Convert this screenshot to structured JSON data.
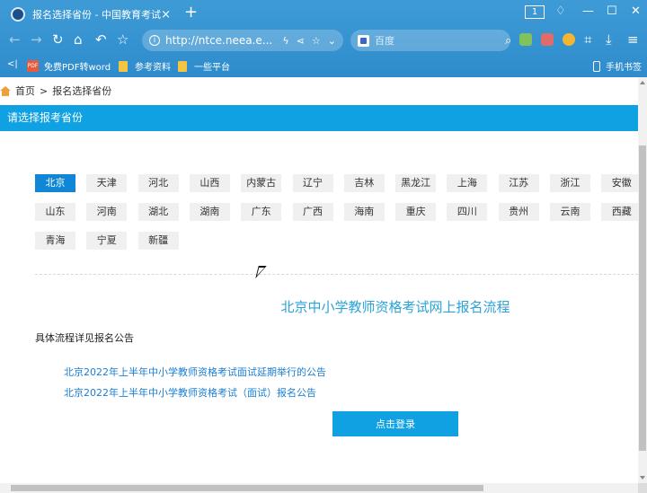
{
  "browser": {
    "tab_title": "报名选择省份 - 中国教育考试网",
    "tab_close": "×",
    "new_tab": "+",
    "tab_count": "1",
    "address": "http://ntce.neea.e...",
    "search_placeholder": "百度",
    "bookmarks": [
      "免费PDF转word",
      "参考资料",
      "一些平台"
    ],
    "mobile_bookmarks": "手机书签",
    "pdf_badge": "PDF"
  },
  "breadcrumb": {
    "home": "首页",
    "separator": ">",
    "current": "报名选择省份"
  },
  "section_header": "请选择报考省份",
  "provinces": [
    {
      "name": "北京",
      "active": true
    },
    {
      "name": "天津"
    },
    {
      "name": "河北"
    },
    {
      "name": "山西"
    },
    {
      "name": "内蒙古"
    },
    {
      "name": "辽宁"
    },
    {
      "name": "吉林"
    },
    {
      "name": "黑龙江"
    },
    {
      "name": "上海"
    },
    {
      "name": "江苏"
    },
    {
      "name": "浙江"
    },
    {
      "name": "安徽"
    },
    {
      "name": "山东"
    },
    {
      "name": "河南"
    },
    {
      "name": "湖北"
    },
    {
      "name": "湖南"
    },
    {
      "name": "广东"
    },
    {
      "name": "广西"
    },
    {
      "name": "海南"
    },
    {
      "name": "重庆"
    },
    {
      "name": "四川"
    },
    {
      "name": "贵州"
    },
    {
      "name": "云南"
    },
    {
      "name": "西藏"
    },
    {
      "name": "青海"
    },
    {
      "name": "宁夏"
    },
    {
      "name": "新疆"
    }
  ],
  "flow_title": "北京中小学教师资格考试网上报名流程",
  "notice_intro": "具体流程详见报名公告",
  "notices": [
    "北京2022年上半年中小学教师资格考试面试延期举行的公告",
    "北京2022年上半年中小学教师资格考试（面试）报名公告"
  ],
  "login_button": "点击登录",
  "colors": {
    "chrome": "#2f8ccc",
    "header": "#0fa1e2",
    "active_province": "#0f86d6",
    "link": "#1a7fd4",
    "title": "#2aa4d8"
  }
}
